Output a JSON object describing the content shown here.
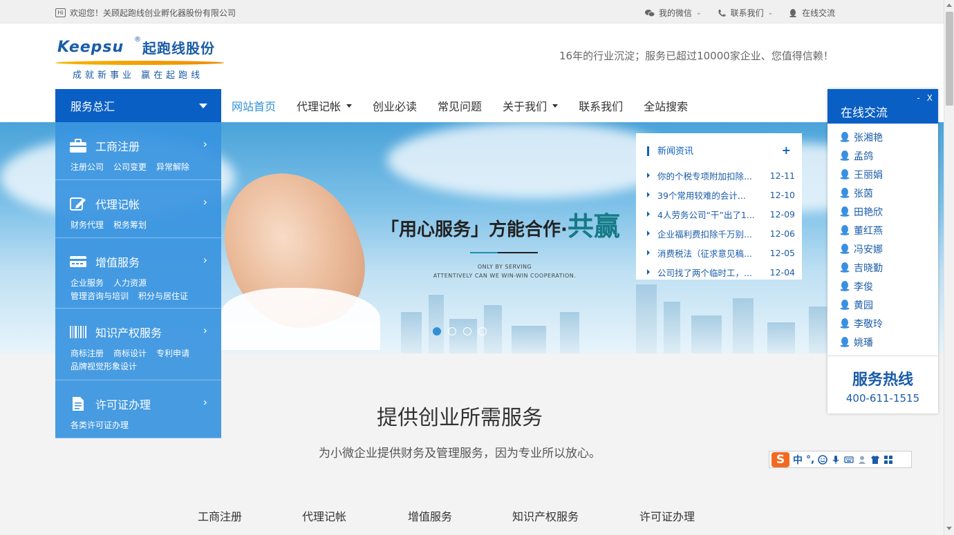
{
  "topbar": {
    "welcome": "欢迎您！关顾起跑线创业孵化器股份有限公司",
    "links": [
      {
        "label": "我的微信",
        "icon": "wechat-icon",
        "has_caret": true
      },
      {
        "label": "联系我们",
        "icon": "phone-icon",
        "has_caret": true
      },
      {
        "label": "在线交流",
        "icon": "qq-icon",
        "has_caret": false
      }
    ]
  },
  "header": {
    "logo_en": "Keepsu",
    "logo_reg": "®",
    "logo_cn": "起跑线股份",
    "logo_slogan": "成就新事业 赢在起跑线",
    "tagline": "16年的行业沉淀；服务已超过10000家企业、您值得信赖！"
  },
  "nav": {
    "service_title": "服务总汇",
    "items": [
      {
        "label": "网站首页",
        "active": true,
        "dropdown": false
      },
      {
        "label": "代理记帐",
        "active": false,
        "dropdown": true
      },
      {
        "label": "创业必读",
        "active": false,
        "dropdown": false
      },
      {
        "label": "常见问题",
        "active": false,
        "dropdown": false
      },
      {
        "label": "关于我们",
        "active": false,
        "dropdown": true
      },
      {
        "label": "联系我们",
        "active": false,
        "dropdown": false
      },
      {
        "label": "全站搜索",
        "active": false,
        "dropdown": false
      }
    ]
  },
  "services": [
    {
      "title": "工商注册",
      "icon": "briefcase-icon",
      "subs": [
        "注册公司",
        "公司变更",
        "异常解除"
      ]
    },
    {
      "title": "代理记帐",
      "icon": "edit-icon",
      "subs": [
        "财务代理",
        "税务筹划"
      ]
    },
    {
      "title": "增值服务",
      "icon": "card-icon",
      "subs": [
        "企业服务",
        "人力资源",
        "管理咨询与培训",
        "积分与居住证"
      ]
    },
    {
      "title": "知识产权服务",
      "icon": "barcode-icon",
      "subs": [
        "商标注册",
        "商标设计",
        "专利申请",
        "品牌视觉形象设计"
      ]
    },
    {
      "title": "许可证办理",
      "icon": "document-icon",
      "subs": [
        "各类许可证办理"
      ]
    }
  ],
  "banner": {
    "title_part1": "「用心服务」方能合作·",
    "title_part2": "共赢",
    "en_line1": "ONLY BY SERVING",
    "en_line2": "ATTENTIVELY CAN WE WIN-WIN COOPERATION.",
    "slide_count": 4,
    "active_slide": 0
  },
  "news": {
    "title": "新闻资讯",
    "more": "+",
    "items": [
      {
        "title": "你的个税专项附加扣除...",
        "date": "12-11"
      },
      {
        "title": "39个常用较难的会计...",
        "date": "12-10"
      },
      {
        "title": "4人劳务公司“干”出了1...",
        "date": "12-09"
      },
      {
        "title": "企业福利费扣除千万别...",
        "date": "12-06"
      },
      {
        "title": "消费税法（征求意见稿...",
        "date": "12-05"
      },
      {
        "title": "公司找了两个临时工，...",
        "date": "12-04"
      }
    ]
  },
  "section": {
    "title": "提供创业所需服务",
    "subtitle": "为小微企业提供财务及管理服务，因为专业所以放心。",
    "tabs": [
      "工商注册",
      "代理记帐",
      "增值服务",
      "知识产权服务",
      "许可证办理"
    ]
  },
  "chat": {
    "title": "在线交流",
    "minimize": "-",
    "close": "X",
    "agents": [
      "张湘艳",
      "孟鸽",
      "王丽娟",
      "张茵",
      "田艳欣",
      "董红燕",
      "冯安娜",
      "吉晓勤",
      "李俊",
      "黄园",
      "李敬玲",
      "姚璠"
    ],
    "hotline_title": "服务热线",
    "hotline_number": "400-611-1515"
  },
  "ime": {
    "logo": "S",
    "mode": "中",
    "punct": "°,"
  },
  "colors": {
    "brand_blue": "#0a5fc4",
    "service_blue": "#3894e0",
    "link_blue": "#1a5ca8",
    "ime_orange": "#f26a22"
  }
}
